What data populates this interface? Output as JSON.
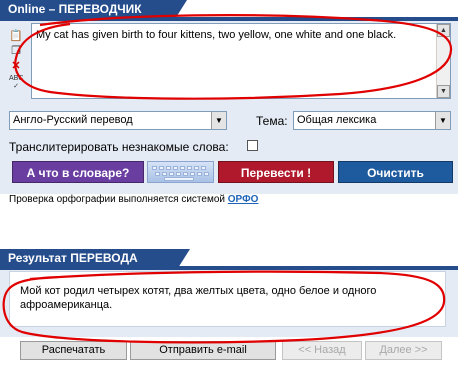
{
  "translator": {
    "header_title": "Online – ПЕРЕВОДЧИК",
    "source_text": "My cat has given birth to four kittens, two yellow, one white and one black.",
    "direction_select": "Англо-Русский перевод",
    "topic_label": "Тема:",
    "topic_select": "Общая лексика",
    "transliterate_label": "Транслитерировать незнакомые слова:",
    "dictionary_button": "А что в словаре?",
    "translate_button": "Перевести !",
    "clear_button": "Очистить",
    "spell_check_prefix": "Проверка орфографии выполняется системой",
    "spell_check_link": "ОРФО",
    "toolbar_icons": [
      "paste-icon",
      "copy-icon",
      "delete-icon",
      "spellcheck-icon"
    ]
  },
  "result": {
    "header_title": "Результат ПЕРЕВОДА",
    "text": "Мой кот родил четырех котят, два желтых цвета, одно белое и одного афроамериканца."
  },
  "bottom_buttons": {
    "print": "Распечатать",
    "email": "Отправить e-mail",
    "back": "<< Назад",
    "next": "Далее >>"
  },
  "colors": {
    "header_blue": "#254d8c",
    "panel_bg": "#e4ebf5",
    "dictionary_button": "#6a3ea1",
    "translate_button": "#b0192b",
    "clear_button": "#1d5a9e",
    "annotation_red": "#e00000"
  }
}
